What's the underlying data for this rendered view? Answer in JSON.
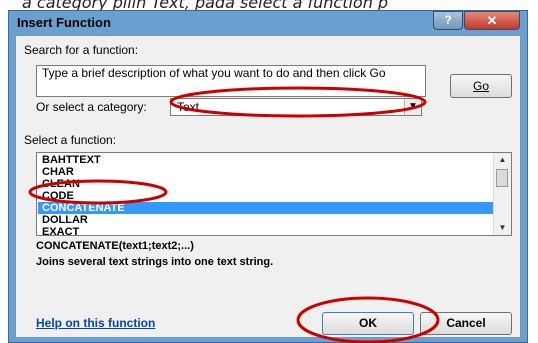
{
  "caption": "a category pilih Text, pada select a function p",
  "dialog": {
    "title": "Insert Function",
    "help_glyph": "?",
    "close_glyph": "✕"
  },
  "search": {
    "label": "Search for a function:",
    "description": "Type a brief description of what you want to do and then click Go",
    "go_label": "Go"
  },
  "category": {
    "label": "Or select a category:",
    "value": "Text",
    "dropdown_glyph": "▼"
  },
  "functions": {
    "label": "Select a function:",
    "items": [
      "BAHTTEXT",
      "CHAR",
      "CLEAN",
      "CODE",
      "CONCATENATE",
      "DOLLAR",
      "EXACT"
    ],
    "selected": "CONCATENATE",
    "scroll_up_glyph": "▲",
    "scroll_down_glyph": "▼"
  },
  "details": {
    "syntax": "CONCATENATE(text1;text2;...)",
    "description": "Joins several text strings into one text string."
  },
  "footer": {
    "help_link": "Help on this function",
    "ok_label": "OK",
    "cancel_label": "Cancel"
  },
  "colors": {
    "selection": "#3399ff",
    "annotation": "#cc0000",
    "titlebar": "#6aa0cf",
    "link": "#0645ad"
  },
  "annotations": [
    "category-dropdown",
    "selected-function",
    "ok-button"
  ]
}
